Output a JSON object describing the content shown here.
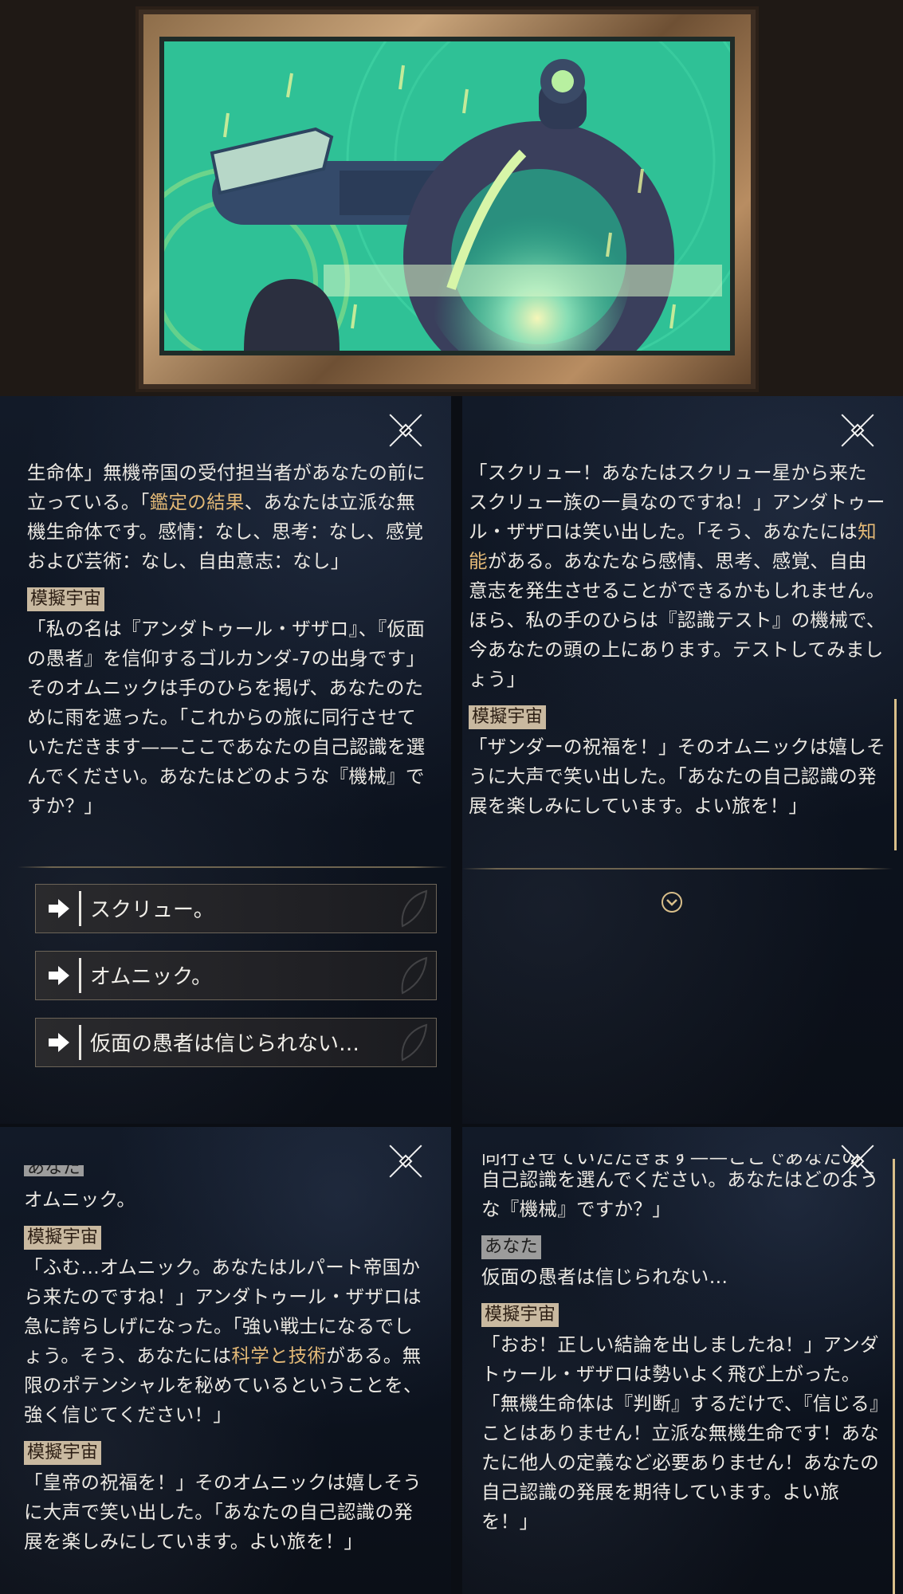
{
  "colors": {
    "highlight": "#e2b876",
    "tag_bg": "#c9b9a0",
    "you_tag_bg": "#9c9c9c",
    "panel_bg": "#0f1522"
  },
  "panel1": {
    "paragraphs": [
      [
        "生命体」無機帝国の受付担当者があなたの前に立っている。「",
        {
          "hl": "鑑定の結果"
        },
        "、あなたは立派な無機生命体です。感情：なし、思考：なし、感覚および芸術：なし、自由意志：なし」"
      ]
    ],
    "speaker": "模擬宇宙",
    "speech": "「私の名は『アンダトゥール・ザザロ』、『仮面の愚者』を信仰するゴルカンダ-7の出身です」そのオムニックは手のひらを掲げ、あなたのために雨を遮った。「これからの旅に同行させていただきます——ここであなたの自己認識を選んでください。あなたはどのような『機械』ですか？」",
    "options": [
      "スクリュー。",
      "オムニック。",
      "仮面の愚者は信じられない…"
    ]
  },
  "panel2": {
    "p1_a": "「スクリュー！あなたはスクリュー星から来たスクリュー族の一員なのですね！」アンダトゥール・ザザロは笑い出した。「そう、あなたには",
    "p1_hl": "知能",
    "p1_b": "がある。あなたなら感情、思考、感覚、自由意志を発生させることができるかもしれません。ほら、私の手のひらは『認識テスト』の機械で、今あなたの頭の上にあります。テストしてみましょう」",
    "speaker": "模擬宇宙",
    "speech": "「ザンダーの祝福を！」そのオムニックは嬉しそうに大声で笑い出した。「あなたの自己認識の発展を楽しみにしています。よい旅を！」"
  },
  "panel3": {
    "cut_tag": "あなた",
    "answer": "オムニック。",
    "speaker1": "模擬宇宙",
    "p1_a": "「ふむ…オムニック。あなたはルパート帝国から来たのですね！」アンダトゥール・ザザロは急に誇らしげになった。「強い戦士になるでしょう。そう、あなたには",
    "p1_hl": "科学と技術",
    "p1_b": "がある。無限のポテンシャルを秘めているということを、強く信じてください！」",
    "speaker2": "模擬宇宙",
    "speech2": "「皇帝の祝福を！」そのオムニックは嬉しそうに大声で笑い出した。「あなたの自己認識の発展を楽しみにしています。よい旅を！」"
  },
  "panel4": {
    "cut_line": "同行させていただきます——ここであなたの",
    "p1": "自己認識を選んでください。あなたはどのような『機械』ですか？」",
    "speaker_you": "あなた",
    "answer": "仮面の愚者は信じられない…",
    "speaker": "模擬宇宙",
    "speech": "「おお！正しい結論を出しましたね！」アンダトゥール・ザザロは勢いよく飛び上がった。「無機生命体は『判断』するだけで、『信じる』ことはありません！立派な無機生命です！あなたに他人の定義など必要ありません！あなたの自己認識の発展を期待しています。よい旅を！」"
  }
}
